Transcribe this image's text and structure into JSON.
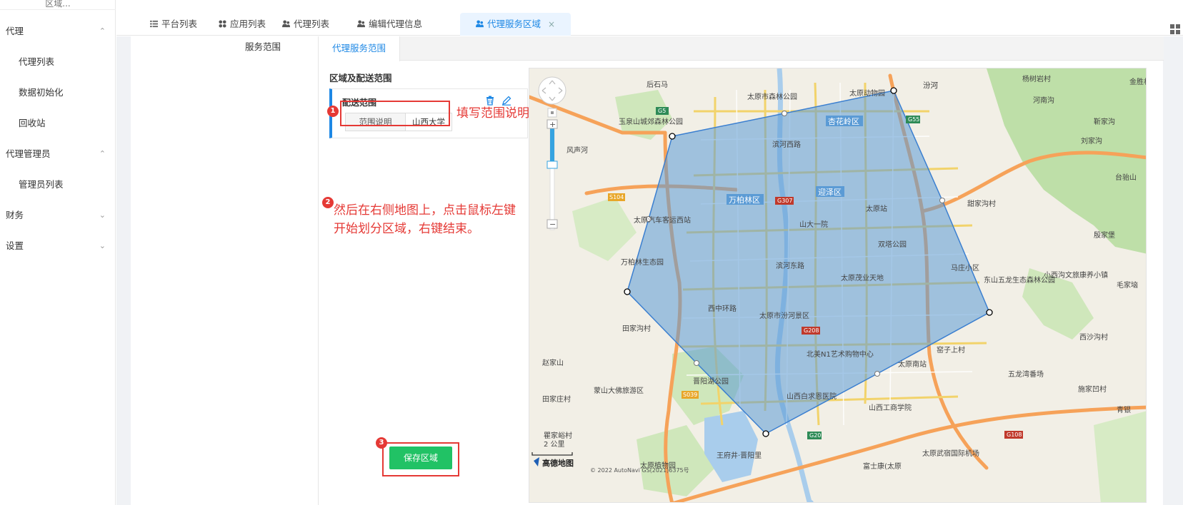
{
  "sidebar": {
    "top_label": "区域...",
    "groups": [
      {
        "label": "代理",
        "chevron": "up"
      },
      {
        "label": "代理管理员",
        "chevron": "up"
      },
      {
        "label": "财务",
        "chevron": "down"
      },
      {
        "label": "设置",
        "chevron": "down"
      }
    ],
    "items": [
      {
        "label": "代理列表"
      },
      {
        "label": "数据初始化"
      },
      {
        "label": "回收站"
      },
      {
        "label": "管理员列表"
      }
    ]
  },
  "tabs": [
    {
      "label": "平台列表",
      "icon": "list-icon",
      "active": false
    },
    {
      "label": "应用列表",
      "icon": "apps-icon",
      "active": false
    },
    {
      "label": "代理列表",
      "icon": "user-group-icon",
      "active": false
    },
    {
      "label": "编辑代理信息",
      "icon": "user-group-icon",
      "active": false
    },
    {
      "label": "代理服务区域",
      "icon": "user-group-icon",
      "active": true,
      "closable": true,
      "close_glyph": "×"
    }
  ],
  "form": {
    "service_range_label": "服务范围",
    "inner_tab": "代理服务范围",
    "area_title": "区域及配送范围",
    "card_title": "配送范围",
    "addon_label": "范围说明",
    "input_value": "山西大学",
    "save_label": "保存区域"
  },
  "annotations": {
    "step1": "1",
    "step2": "2",
    "step3": "3",
    "step1_text": "填写范围说明",
    "step2_text_line1": "然后在右侧地图上，点击鼠标左键",
    "step2_text_line2": "开始划分区域，右键结束。"
  },
  "map": {
    "scale": "2 公里",
    "logo": "高德地图",
    "copyright": "© 2022 AutoNavi GS(2021)6375号",
    "districts": [
      "杏花岭区",
      "万柏林区",
      "迎泽区"
    ],
    "places": [
      "太原市森林公园",
      "太原动物园",
      "玉泉山城郊森林公园",
      "风声河",
      "太原汽车客运西站",
      "山大一院",
      "太原站",
      "双塔公园",
      "万柏林生态园",
      "太原茂业天地",
      "太原市汾河景区",
      "北美N1艺术购物中心",
      "太原南站",
      "晋阳湖公园",
      "蒙山大佛旅游区",
      "山西白求恩医院",
      "山西工商学院",
      "太原武宿国际机场",
      "富士康(太原",
      "五龙湾番场",
      "东山五龙生态森林公园",
      "小西沟文旅康养小镇",
      "马庄小区",
      "台骀山",
      "田家沟村",
      "赵家山",
      "田家庄村",
      "窑子上村",
      "西沙沟村",
      "施家凹村",
      "毛家垴",
      "杨树岩村",
      "河南沟",
      "甜家沟村",
      "刘家沟",
      "靳家沟",
      "殷家堡",
      "后石马",
      "青银",
      "滨河西路",
      "西中环路",
      "滨河东路",
      "王府井·晋阳里",
      "太原植物园",
      "瞿家峪村",
      "金胜村"
    ],
    "road_labels": [
      "G5",
      "G55",
      "G307",
      "G208",
      "G20",
      "S104",
      "S039",
      "G108"
    ],
    "river": "汾河",
    "colors": {
      "polygon_fill": "#5b9bd5",
      "polygon_stroke": "#3b7fd0",
      "map_bg": "#f2efe6",
      "green": "#b9dba4",
      "road_orange": "#f6a259"
    }
  },
  "colors": {
    "accent": "#1e88e5",
    "annotation_red": "#e53935",
    "save_green": "#21c265"
  }
}
